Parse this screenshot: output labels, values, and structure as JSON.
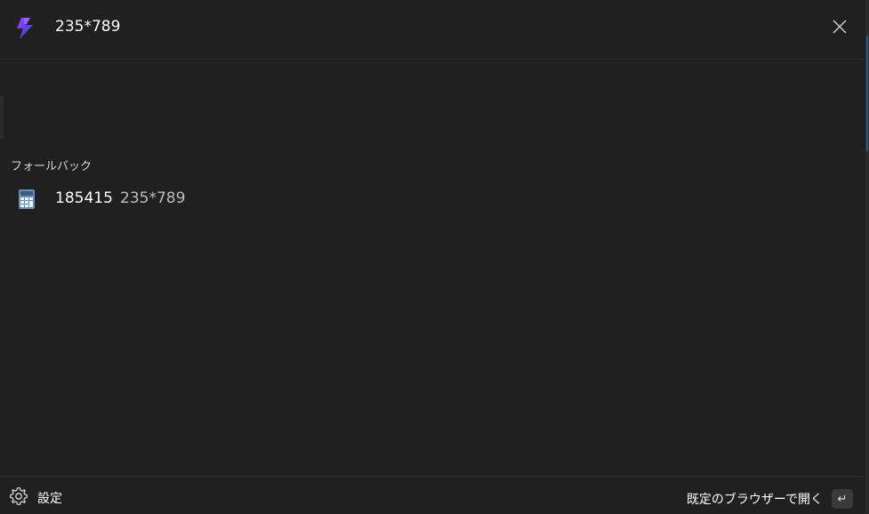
{
  "search": {
    "query": "235*789",
    "app_icon": "lightning-bolt-icon",
    "close_icon": "close-icon"
  },
  "results": {
    "section_header": "フォールバック",
    "items": [
      {
        "icon": "calculator-icon",
        "title": "185415",
        "subtitle": "235*789"
      }
    ]
  },
  "footer": {
    "settings_icon": "gear-icon",
    "settings_label": "設定",
    "open_browser_label": "既定のブラウザーで開く",
    "enter_key_glyph": "↵"
  },
  "colors": {
    "background": "#202020",
    "divider": "#2e2e2e",
    "primary_text": "#ffffff",
    "secondary_text": "#bdbdbd",
    "bolt_purple": "#7b3fe4",
    "bolt_blue": "#2d8cff"
  }
}
